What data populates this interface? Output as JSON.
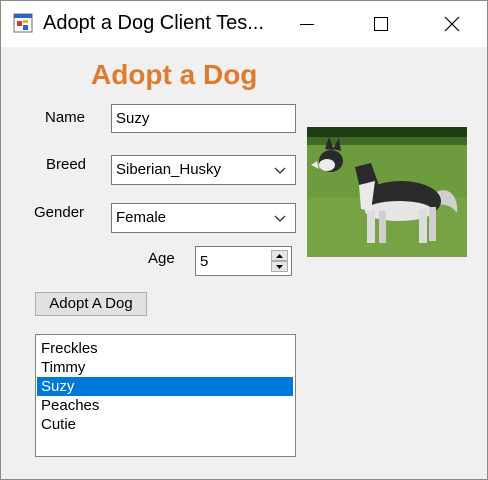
{
  "window": {
    "title": "Adopt a Dog Client Tes..."
  },
  "form": {
    "heading": "Adopt a Dog",
    "name": {
      "label": "Name",
      "value": "Suzy"
    },
    "breed": {
      "label": "Breed",
      "selected": "Siberian_Husky"
    },
    "gender": {
      "label": "Gender",
      "selected": "Female"
    },
    "age": {
      "label": "Age",
      "value": "5"
    },
    "adopt_button": "Adopt A Dog"
  },
  "dog_list": {
    "items": [
      "Freckles",
      "Timmy",
      "Suzy",
      "Peaches",
      "Cutie"
    ],
    "selected": "Suzy"
  },
  "colors": {
    "heading": "#e07a2e",
    "selection": "#0078d7"
  }
}
